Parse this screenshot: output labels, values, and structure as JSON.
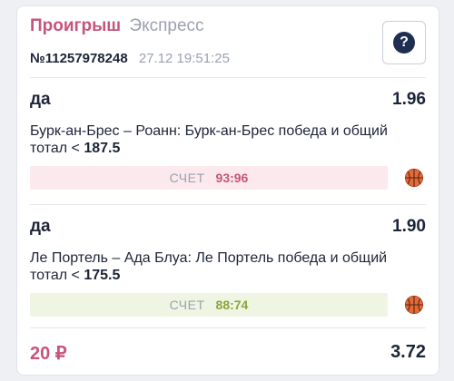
{
  "bet": {
    "result": "Проигрыш",
    "type": "Экспресс",
    "id": "№11257978248",
    "date": "27.12 19:51:25",
    "help_label": "?"
  },
  "events": [
    {
      "pick": "да",
      "odds": "1.96",
      "description": "Бурк-ан-Брес – Роанн: Бурк-ан-Брес победа и общий тотал < ",
      "line": "187.5",
      "score_label": "СЧЕТ",
      "score": "93:96",
      "outcome": "loss",
      "sport_icon": "basketball-icon"
    },
    {
      "pick": "да",
      "odds": "1.90",
      "description": "Ле Портель – Ада Блуа: Ле Портель победа и общий тотал < ",
      "line": "175.5",
      "score_label": "СЧЕТ",
      "score": "88:74",
      "outcome": "win",
      "sport_icon": "basketball-icon"
    }
  ],
  "footer": {
    "stake": "20 ₽",
    "total_odds": "3.72"
  },
  "colors": {
    "loss": "#c6557a",
    "win": "#8aa539",
    "basketball": "#e36a3a"
  }
}
